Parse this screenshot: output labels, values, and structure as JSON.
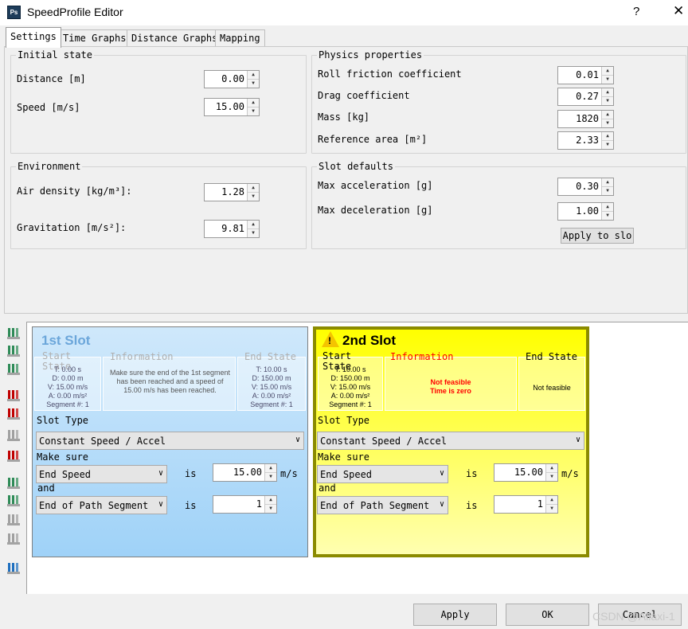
{
  "window": {
    "title": "SpeedProfile Editor",
    "app_icon": "Ps",
    "help": "?",
    "close": "✕"
  },
  "tabs": [
    "Settings",
    "Time Graphs",
    "Distance Graphs",
    "Mapping"
  ],
  "initial_state": {
    "title": "Initial state",
    "distance": {
      "label": "Distance [m]",
      "value": "0.00"
    },
    "speed": {
      "label": "Speed [m/s]",
      "value": "15.00"
    }
  },
  "environment": {
    "title": "Environment",
    "air_density": {
      "label": "Air density [kg/m³]:",
      "value": "1.28"
    },
    "gravitation": {
      "label": "Gravitation [m/s²]:",
      "value": "9.81"
    }
  },
  "physics": {
    "title": "Physics properties",
    "roll": {
      "label": "Roll friction coefficient",
      "value": "0.01"
    },
    "drag": {
      "label": "Drag coefficient",
      "value": "0.27"
    },
    "mass": {
      "label": "Mass [kg]",
      "value": "1820"
    },
    "area": {
      "label": "Reference area [m²]",
      "value": "2.33"
    }
  },
  "slot_defaults": {
    "title": "Slot defaults",
    "max_acc": {
      "label": "Max acceleration [g]",
      "value": "0.30"
    },
    "max_dec": {
      "label": "Max deceleration [g]",
      "value": "1.00"
    },
    "apply_button": "Apply to slo"
  },
  "toolbar_icons": [
    "add-slot-icon",
    "insert-slot-icon",
    "add-slot-after-icon",
    "delete-slot-icon",
    "delete-slot-red-icon",
    "delete-disabled-icon",
    "delete-all-icon",
    "move-slot-left-icon",
    "move-slot-right-icon",
    "move-disabled-icon",
    "move-disabled-2-icon",
    "export-icon"
  ],
  "slot1": {
    "name": "1st Slot",
    "start_hd": "Start State",
    "start_lines": [
      "T: 0.00 s",
      "D: 0.00 m",
      "V: 15.00 m/s",
      "A: 0.00 m/s²",
      "Segment #: 1"
    ],
    "info_hd": "Information",
    "info_text": "Make sure the end of the 1st segment has been reached and a speed of 15.00 m/s has been reached.",
    "end_hd": "End State",
    "end_lines": [
      "T: 10.00 s",
      "D: 150.00 m",
      "V: 15.00 m/s",
      "A: 0.00 m/s²",
      "Segment #: 1"
    ],
    "slot_type_label": "Slot Type",
    "slot_type": "Constant Speed / Accel",
    "make_sure": "Make sure",
    "cond1": "End Speed",
    "is1": "is",
    "val1": "15.00",
    "unit1": "m/s",
    "and": "and",
    "cond2": "End of Path Segment I",
    "is2": "is",
    "val2": "1"
  },
  "slot2": {
    "name": "2nd Slot",
    "warning": "!",
    "start_hd": "Start State",
    "start_lines": [
      "T: 10.00 s",
      "D: 150.00 m",
      "V: 15.00 m/s",
      "A: 0.00 m/s²",
      "Segment #: 1"
    ],
    "info_hd": "Information",
    "info_text1": "Not feasible",
    "info_text2": "Time is zero",
    "end_hd": "End State",
    "end_text": "Not feasible",
    "slot_type_label": "Slot Type",
    "slot_type": "Constant Speed / Accel",
    "make_sure": "Make sure",
    "cond1": "End Speed",
    "is1": "is",
    "val1": "15.00",
    "unit1": "m/s",
    "and": "and",
    "cond2": "End of Path Segment I",
    "is2": "is",
    "val2": "1"
  },
  "buttons": {
    "apply": "Apply",
    "ok": "OK",
    "cancel": "Cancel"
  },
  "watermark": "CSDN @Allaxi-1",
  "colors": {
    "info_red": "#ff0000",
    "slot1_bg": "#a8d6f8",
    "slot2_bg": "#ffff40",
    "slot2_border": "#8b8b00"
  }
}
